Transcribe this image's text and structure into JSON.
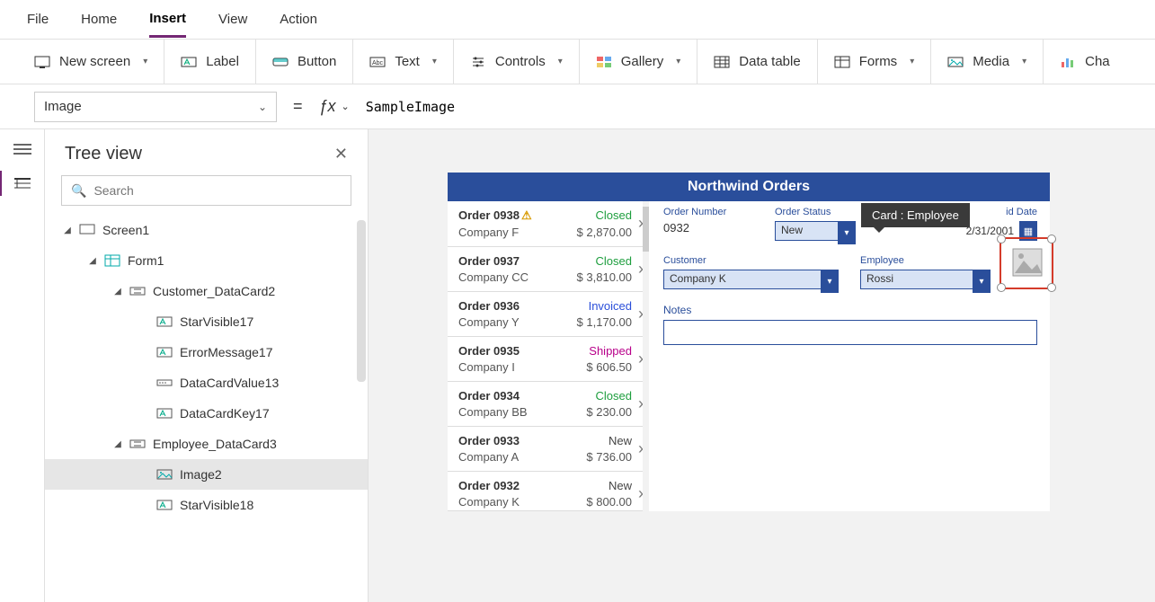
{
  "menu": {
    "file": "File",
    "home": "Home",
    "insert": "Insert",
    "view": "View",
    "action": "Action"
  },
  "ribbon": {
    "newscreen": "New screen",
    "label": "Label",
    "button": "Button",
    "text": "Text",
    "controls": "Controls",
    "gallery": "Gallery",
    "datatable": "Data table",
    "forms": "Forms",
    "media": "Media",
    "charts": "Cha"
  },
  "formulabar": {
    "property": "Image",
    "formula": "SampleImage"
  },
  "treepanel": {
    "title": "Tree view",
    "search_placeholder": "Search",
    "nodes": {
      "screen1": "Screen1",
      "form1": "Form1",
      "customer_dc": "Customer_DataCard2",
      "starvisible17": "StarVisible17",
      "errormessage17": "ErrorMessage17",
      "datacardvalue13": "DataCardValue13",
      "datacardkey17": "DataCardKey17",
      "employee_dc": "Employee_DataCard3",
      "image2": "Image2",
      "starvisible18": "StarVisible18"
    }
  },
  "app": {
    "title": "Northwind Orders",
    "orders": [
      {
        "id": "Order 0938",
        "warn": true,
        "status": "Closed",
        "company": "Company F",
        "amount": "$ 2,870.00"
      },
      {
        "id": "Order 0937",
        "warn": false,
        "status": "Closed",
        "company": "Company CC",
        "amount": "$ 3,810.00"
      },
      {
        "id": "Order 0936",
        "warn": false,
        "status": "Invoiced",
        "company": "Company Y",
        "amount": "$ 1,170.00"
      },
      {
        "id": "Order 0935",
        "warn": false,
        "status": "Shipped",
        "company": "Company I",
        "amount": "$ 606.50"
      },
      {
        "id": "Order 0934",
        "warn": false,
        "status": "Closed",
        "company": "Company BB",
        "amount": "$ 230.00"
      },
      {
        "id": "Order 0933",
        "warn": false,
        "status": "New",
        "company": "Company A",
        "amount": "$ 736.00"
      },
      {
        "id": "Order 0932",
        "warn": false,
        "status": "New",
        "company": "Company K",
        "amount": "$ 800.00"
      }
    ],
    "form": {
      "ordernumber_label": "Order Number",
      "ordernumber_value": "0932",
      "orderstatus_label": "Order Status",
      "orderstatus_value": "New",
      "paiddate_label": "id Date",
      "paiddate_value": "2/31/2001",
      "customer_label": "Customer",
      "customer_value": "Company K",
      "employee_label": "Employee",
      "employee_value": "Rossi",
      "notes_label": "Notes"
    },
    "tooltip": "Card : Employee"
  }
}
